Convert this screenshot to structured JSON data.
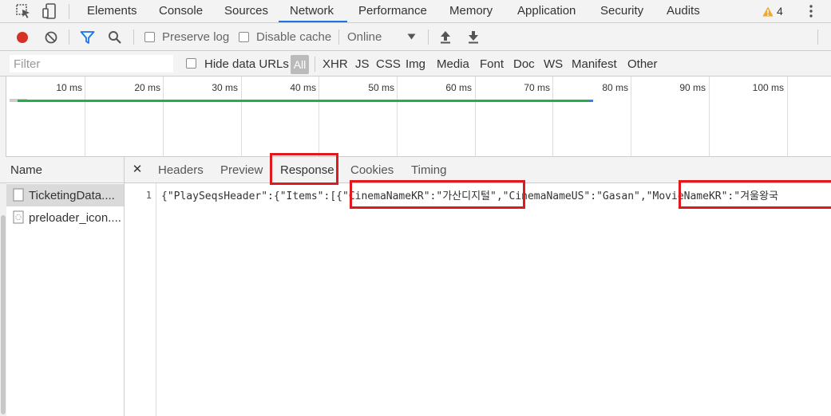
{
  "tabs": [
    {
      "label": "Elements"
    },
    {
      "label": "Console"
    },
    {
      "label": "Sources"
    },
    {
      "label": "Network",
      "active": true
    },
    {
      "label": "Performance"
    },
    {
      "label": "Memory"
    },
    {
      "label": "Application"
    },
    {
      "label": "Security"
    },
    {
      "label": "Audits"
    }
  ],
  "warnings": {
    "count": "4",
    "color": "#f5a623"
  },
  "toolbar": {
    "preserve_log": "Preserve log",
    "disable_cache": "Disable cache",
    "throttling": "Online",
    "record_color": "#d93025",
    "filter_icon_color": "#1a73e8"
  },
  "filter": {
    "placeholder": "Filter",
    "hide_data_urls": "Hide data URLs",
    "types": [
      "All",
      "XHR",
      "JS",
      "CSS",
      "Img",
      "Media",
      "Font",
      "Doc",
      "WS",
      "Manifest",
      "Other"
    ]
  },
  "timeline": {
    "ticks": [
      "10 ms",
      "20 ms",
      "30 ms",
      "40 ms",
      "50 ms",
      "60 ms",
      "70 ms",
      "80 ms",
      "90 ms",
      "100 ms"
    ],
    "bar_color": "#20b04b"
  },
  "requests": {
    "header": "Name",
    "items": [
      {
        "name": "TicketingData....",
        "selected": true
      },
      {
        "name": "preloader_icon...."
      }
    ]
  },
  "detail": {
    "tabs": [
      "Headers",
      "Preview",
      "Response",
      "Cookies",
      "Timing"
    ],
    "active_tab": "Response",
    "line_number": "1",
    "response": {
      "part1": "{\"PlaySeqsHeader\":{\"Items\":[{",
      "part2": "\"CinemaNameKR\":\"가산디지털",
      "part3": "\",\"CinemaNameUS\":\"Gasan\"",
      "part4": ",\"MovieNameKR\":\"겨울왕국"
    }
  },
  "highlight_color": "#e0191f"
}
